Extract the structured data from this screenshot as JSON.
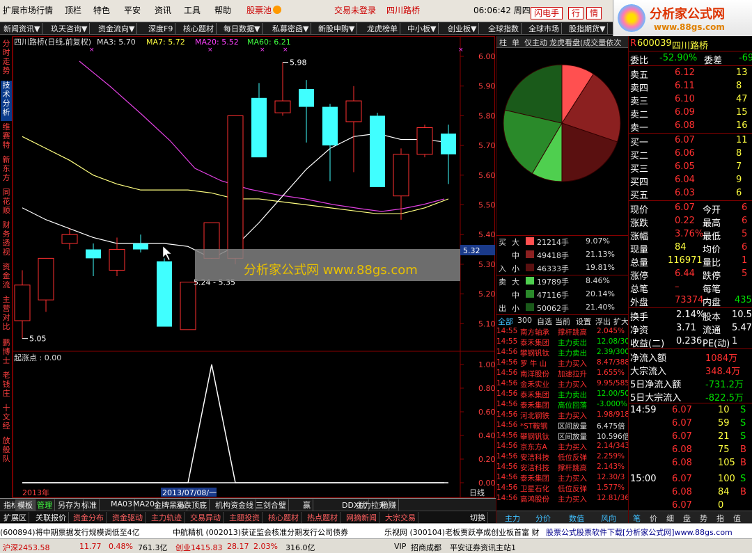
{
  "menu": [
    "扩展市场行情",
    "顶栏",
    "特色",
    "平安",
    "资讯",
    "工具",
    "帮助"
  ],
  "menu_right": {
    "pool": "股票池",
    "trade_status": "交易未登录",
    "stock": "四川路桥",
    "time": "06:06:42 周四",
    "flash": "闪电手",
    "row": "行",
    "info": "情"
  },
  "logo": {
    "title": "分析家公式网",
    "url": "www.88gs.com"
  },
  "toolbar": [
    "新闻资讯▼",
    "玖天咨询▼",
    "资金流向▼",
    "深度F9",
    "核心题材",
    "每日数据▼",
    "私募密函▼",
    "新股申购▼",
    "龙虎榜单",
    "中小板▼",
    "创业板▼",
    "全球指数",
    "全球市场",
    "股指期货▼"
  ],
  "leftnav": [
    {
      "label": "分时走势",
      "on": false
    },
    {
      "label": "技术分析",
      "on": true
    },
    {
      "label": "维赛特",
      "on": false
    },
    {
      "label": "新东方",
      "on": false
    },
    {
      "label": "同花顺",
      "on": false
    },
    {
      "label": "财务透视",
      "on": false
    },
    {
      "label": "资金流",
      "on": false
    },
    {
      "label": "主营对比",
      "on": false
    },
    {
      "label": "鹏博士",
      "on": false
    },
    {
      "label": "老钱庄",
      "on": false
    },
    {
      "label": "十文经",
      "on": false
    },
    {
      "label": "放般队",
      "on": false
    }
  ],
  "chart_header": {
    "name": "四川路桥(日线,前复权)",
    "ma3": "MA3: 5.70",
    "ma7": "MA7: 5.72",
    "ma20": "MA20: 5.52",
    "ma60": "MA60: 6.21"
  },
  "chart_data": {
    "type": "candlestick",
    "yticks": [
      "6.00",
      "5.90",
      "5.80",
      "5.70",
      "5.60",
      "5.50",
      "5.40",
      "5.30",
      "5.20",
      "5.10"
    ],
    "candles": [
      {
        "o": 5.11,
        "c": 5.23,
        "h": 5.28,
        "l": 5.05,
        "up": true
      },
      {
        "o": 5.18,
        "c": 5.32,
        "h": 5.32,
        "l": 5.14,
        "up": true
      },
      {
        "o": 5.37,
        "c": 5.4,
        "h": 5.42,
        "l": 5.35,
        "up": true
      },
      {
        "o": 5.35,
        "c": 5.32,
        "h": 5.37,
        "l": 5.26,
        "up": false
      },
      {
        "o": 5.28,
        "c": 5.35,
        "h": 5.39,
        "l": 5.26,
        "up": true
      },
      {
        "o": 5.37,
        "c": 5.35,
        "h": 5.4,
        "l": 5.34,
        "up": false
      },
      {
        "o": 5.31,
        "c": 5.09,
        "h": 5.32,
        "l": 5.09,
        "up": false
      },
      {
        "o": 5.08,
        "c": 5.24,
        "h": 5.24,
        "l": 5.08,
        "up": true
      },
      {
        "o": 5.32,
        "c": 5.44,
        "h": 5.44,
        "l": 5.32,
        "up": true
      },
      {
        "o": 5.32,
        "c": 5.8,
        "h": 5.8,
        "l": 5.3,
        "up": true
      },
      {
        "o": 5.66,
        "c": 5.86,
        "h": 5.91,
        "l": 5.66,
        "up": false
      },
      {
        "o": 5.81,
        "c": 5.85,
        "h": 5.98,
        "l": 5.8,
        "up": true
      },
      {
        "o": 5.89,
        "c": 5.83,
        "h": 5.92,
        "l": 5.71,
        "up": false
      },
      {
        "o": 5.83,
        "c": 5.7,
        "h": 5.84,
        "l": 5.58,
        "up": false
      },
      {
        "o": 5.78,
        "c": 5.85,
        "h": 5.9,
        "l": 5.61,
        "up": true
      },
      {
        "o": 5.8,
        "c": 5.56,
        "h": 5.81,
        "l": 5.56,
        "up": false
      },
      {
        "o": 5.53,
        "c": 5.67,
        "h": 5.69,
        "l": 5.45,
        "up": true
      },
      {
        "o": 5.67,
        "c": 5.76,
        "h": 5.77,
        "l": 5.66,
        "up": true
      },
      {
        "o": 5.74,
        "c": 5.67,
        "h": 5.77,
        "l": 5.57,
        "up": false
      }
    ],
    "ma_short": [
      5.24,
      5.25,
      5.33,
      5.36,
      5.37,
      5.37,
      5.37,
      5.36,
      5.3,
      5.27,
      5.46,
      5.73,
      5.84,
      5.84,
      5.84,
      5.79,
      5.71,
      5.73,
      5.69
    ],
    "ma_mid": [
      5.73,
      5.69,
      5.65,
      5.6,
      5.57,
      5.55,
      5.55,
      5.55,
      5.54,
      5.52,
      5.52,
      5.51,
      5.5,
      5.49,
      5.48,
      5.47,
      5.47,
      5.49,
      5.52
    ],
    "ma_long": [
      5.49,
      5.45,
      5.42,
      5.39,
      5.37,
      5.37,
      5.37,
      5.36,
      5.32,
      5.36,
      5.44,
      5.53,
      5.62,
      5.69,
      5.73,
      5.74,
      5.72,
      5.72,
      5.71
    ],
    "labels": {
      "high": "5.98",
      "low": "5.05",
      "range": "5.24 - 5.35",
      "price_tag": "5.32"
    },
    "indicator": {
      "name": "起涨点 : 0.00",
      "yticks": [
        "1.00",
        "0.80",
        "0.60",
        "0.40",
        "0.20",
        "0.00"
      ],
      "values": [
        0,
        0,
        0,
        0,
        0,
        0,
        0,
        0,
        1,
        0,
        0,
        0,
        0,
        0,
        0,
        0,
        0,
        0,
        0
      ]
    },
    "xlabels": {
      "year": "2013年",
      "date": "2013/07/08/一"
    }
  },
  "watermark": "分析家公式网  www.88gs.com",
  "period": "日线",
  "bottom_tabs": [
    "指标",
    "模板",
    "管理",
    "另存为",
    "标准",
    "MA03",
    "MA20",
    "金牌黑马",
    "涨跌顶底",
    "机构资金线",
    "三剑合璧",
    "赢",
    "DDX优",
    "主力拉升",
    "稳赚"
  ],
  "bottom_tabs2": [
    "扩展区",
    "关联报价",
    "资金分布",
    "资金驱动",
    "主力轨迹",
    "交易异动",
    "主题投资",
    "核心题材",
    "热点题材",
    "网摘新闻",
    "大宗交易"
  ],
  "cut": "切换",
  "mid_tabs": [
    "柱",
    "单",
    "仅主动",
    "龙虎看盘(成交量依次"
  ],
  "pie": {
    "slices": [
      {
        "pct": 9.07,
        "color": "#ff5050"
      },
      {
        "pct": 21.13,
        "color": "#8b2020"
      },
      {
        "pct": 19.81,
        "color": "#5a1010"
      },
      {
        "pct": 8.46,
        "color": "#4fcf4f"
      },
      {
        "pct": 20.14,
        "color": "#2a8a2a"
      },
      {
        "pct": 21.4,
        "color": "#1a5a1a"
      }
    ]
  },
  "flow_in": [
    {
      "label": "大",
      "v": "21214手",
      "p": "9.07%",
      "color": "#ff5050"
    },
    {
      "label": "中",
      "v": "49418手",
      "p": "21.13%",
      "color": "#8b2020"
    },
    {
      "label": "小",
      "v": "46333手",
      "p": "19.81%",
      "color": "#5a1010"
    }
  ],
  "flow_out": [
    {
      "label": "大",
      "v": "19789手",
      "p": "8.46%",
      "color": "#4fcf4f"
    },
    {
      "label": "中",
      "v": "47116手",
      "p": "20.14%",
      "color": "#2a8a2a"
    },
    {
      "label": "小",
      "v": "50062手",
      "p": "21.40%",
      "color": "#1a5a1a"
    }
  ],
  "flow_side": {
    "buy": "买",
    "in": "入",
    "sell": "卖",
    "out": "出"
  },
  "news_tabs": [
    "全部",
    "300",
    "自选",
    "当前",
    "设置",
    "浮出",
    "扩大"
  ],
  "news": [
    [
      "14:55",
      "南方轴承",
      "撑杆跳高",
      "2.045%",
      "red"
    ],
    [
      "14:55",
      "泰禾集团",
      "主力卖出",
      "12.08/30",
      "grn"
    ],
    [
      "14:56",
      "攀钢钒钛",
      "主力卖出",
      "2.39/300",
      "grn"
    ],
    [
      "14:56",
      "罗 牛 山",
      "主力买入",
      "8.47/388",
      "red"
    ],
    [
      "14:56",
      "南洋股份",
      "加速拉升",
      "1.655%",
      "red"
    ],
    [
      "14:56",
      "金禾实业",
      "主力买入",
      "9.95/585",
      "red"
    ],
    [
      "14:56",
      "泰禾集团",
      "主力卖出",
      "12.00/50",
      "grn"
    ],
    [
      "14:56",
      "泰禾集团",
      "高位回落",
      "-3.000%",
      "grn"
    ],
    [
      "14:56",
      "河北钢铁",
      "主力买入",
      "1.98/918",
      "red"
    ],
    [
      "14:56",
      "*ST鞍钢",
      "区间放量",
      "6.475倍",
      "wht"
    ],
    [
      "14:56",
      "攀钢钒钛",
      "区间放量",
      "10.596倍",
      "wht"
    ],
    [
      "14:56",
      "京东方A",
      "主力买入",
      "2.14/343",
      "red"
    ],
    [
      "14:56",
      "安洁科技",
      "低位反弹",
      "2.259%",
      "red"
    ],
    [
      "14:56",
      "安洁科技",
      "撑杆跳高",
      "2.143%",
      "red"
    ],
    [
      "14:56",
      "泰禾集团",
      "主力买入",
      "12.30/3",
      "red"
    ],
    [
      "14:56",
      "卫星石化",
      "低位反弹",
      "1.577%",
      "red"
    ],
    [
      "14:56",
      "高鸿股份",
      "主力买入",
      "12.81/36",
      "red"
    ]
  ],
  "mid_bottom": [
    "主力",
    "分价",
    "数值",
    "风向"
  ],
  "quote": {
    "code": "600039",
    "name": "四川路桥",
    "weibi_label": "委比",
    "weibi": "-52.90%",
    "weicha_label": "委差",
    "weicha": "-69",
    "asks": [
      [
        "卖五",
        "6.12",
        "13"
      ],
      [
        "卖四",
        "6.11",
        "8"
      ],
      [
        "卖三",
        "6.10",
        "47"
      ],
      [
        "卖二",
        "6.09",
        "15"
      ],
      [
        "卖一",
        "6.08",
        "16"
      ]
    ],
    "bids": [
      [
        "买一",
        "6.07",
        "11"
      ],
      [
        "买二",
        "6.06",
        "8"
      ],
      [
        "买三",
        "6.05",
        "7"
      ],
      [
        "买四",
        "6.04",
        "9"
      ],
      [
        "买五",
        "6.03",
        "6"
      ]
    ],
    "stats": [
      [
        "现价",
        "6.07",
        "今开",
        "6"
      ],
      [
        "涨跌",
        "0.22",
        "最高",
        "6"
      ],
      [
        "涨幅",
        "3.76%",
        "最低",
        "5"
      ],
      [
        "现量",
        "84",
        "均价",
        "6"
      ],
      [
        "总量",
        "116971",
        "量比",
        "1"
      ],
      [
        "涨停",
        "6.44",
        "跌停",
        "5"
      ],
      [
        "总笔",
        "–",
        "每笔",
        ""
      ],
      [
        "外盘",
        "73374",
        "内盘",
        "435"
      ]
    ],
    "fin": [
      [
        "换手",
        "2.14%",
        "股本",
        "10.5"
      ],
      [
        "净资",
        "3.71",
        "流通",
        "5.47"
      ],
      [
        "收益(二)",
        "0.236",
        "PE(动)",
        "1"
      ]
    ],
    "flows": [
      [
        "净流入额",
        "1084万"
      ],
      [
        "大宗流入",
        "348.4万"
      ],
      [
        "5日净流入额",
        "-731.2万"
      ],
      [
        "5日大宗流入",
        "-822.5万"
      ]
    ],
    "ticks1_time": "14:59",
    "ticks1": [
      [
        "6.07",
        "10",
        "S"
      ],
      [
        "6.07",
        "59",
        "S"
      ],
      [
        "6.07",
        "21",
        "S"
      ],
      [
        "6.08",
        "75",
        "B"
      ],
      [
        "6.08",
        "105",
        "B"
      ]
    ],
    "ticks2_time": "15:00",
    "ticks2": [
      [
        "6.07",
        "100",
        "S"
      ],
      [
        "6.08",
        "84",
        "B"
      ],
      [
        "6.07",
        "0",
        ""
      ]
    ]
  },
  "right_tabs": [
    "笔",
    "价",
    "细",
    "盘",
    "势",
    "指",
    "值"
  ],
  "ticker": [
    "(600894)将中期票据发行规模调低至4亿",
    "中航精机 (002013)获证监会核准分期发行公司债券",
    "乐视网 (300104)老板贾跃亭成创业板首富 财",
    "股票公式股票软件下载[分析家公式网]www.88gs.com"
  ],
  "status": [
    "沪深2453.58",
    "11.77",
    "0.48%",
    "761.3亿",
    "创业1415.83",
    "28.17",
    "2.03%",
    "316.0亿",
    "VIP",
    "招商成都",
    "平安证券资讯主站1"
  ]
}
